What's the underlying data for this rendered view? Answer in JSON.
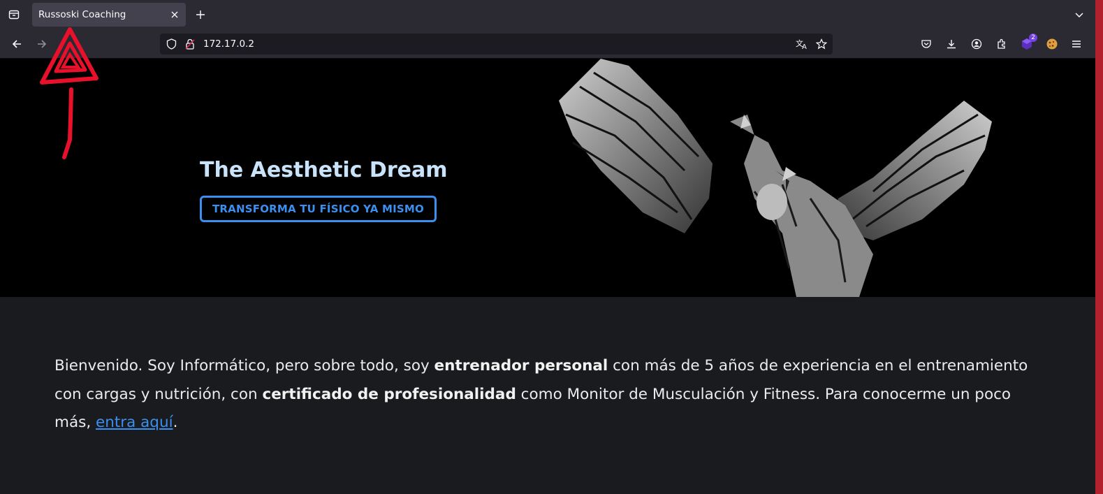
{
  "browser": {
    "tab": {
      "title": "Russoski Coaching"
    },
    "url": "172.17.0.2",
    "extensions_badge": "2",
    "icons": [
      "tab-overview-icon",
      "close-icon",
      "plus-icon",
      "chevron-down-icon",
      "back-arrow-icon",
      "forward-arrow-icon",
      "shield-icon",
      "lock-icon",
      "translate-icon",
      "star-icon",
      "pocket-icon",
      "download-icon",
      "account-icon",
      "extensions-icon",
      "puzzle-icon",
      "cookie-icon",
      "menu-icon"
    ]
  },
  "hero": {
    "title": "The Aesthetic Dream",
    "cta": "TRANSFORMA TU FÍSICO YA MISMO"
  },
  "intro": {
    "part1": "Bienvenido. Soy Informático, pero sobre todo, soy ",
    "bold1": "entrenador personal",
    "part2": " con más de 5 años de experiencia en el entrenamiento con cargas y nutrición, con ",
    "bold2": "certificado de profesionalidad",
    "part3": " como Monitor de Musculación y Fitness. Para conocerme un poco más, ",
    "link": "entra aquí",
    "part4": "."
  },
  "colors": {
    "accent": "#3b8fef",
    "hero_title": "#c9e3fb",
    "annotation": "#e8102a"
  }
}
